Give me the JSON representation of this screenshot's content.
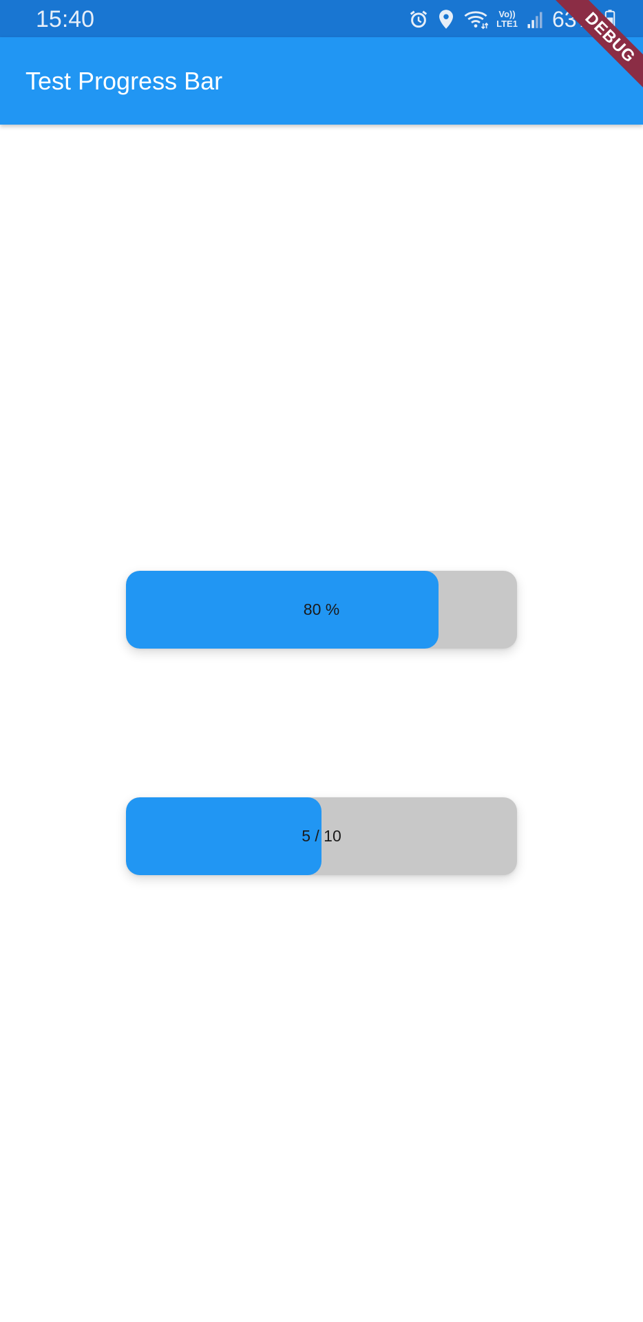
{
  "status_bar": {
    "time": "15:40",
    "battery": "63%",
    "network_label_top": "Vo))",
    "network_label_bottom": "LTE1",
    "icons": [
      "alarm-icon",
      "location-icon",
      "wifi-icon",
      "lte-icon",
      "signal-icon",
      "battery-icon"
    ]
  },
  "app_bar": {
    "title": "Test Progress Bar",
    "color": "#2196f3"
  },
  "debug_banner": {
    "label": "DEBUG"
  },
  "progress_bars": [
    {
      "label": "80 %",
      "fraction": 0.8,
      "fill_color": "#2196f3",
      "track_color": "#c8c8c8"
    },
    {
      "label": "5 / 10",
      "current": 5,
      "total": 10,
      "fraction": 0.5,
      "fill_color": "#2196f3",
      "track_color": "#c8c8c8"
    }
  ],
  "colors": {
    "status_bar": "#1976d2",
    "accent": "#2196f3",
    "debug": "#8b2d45"
  }
}
